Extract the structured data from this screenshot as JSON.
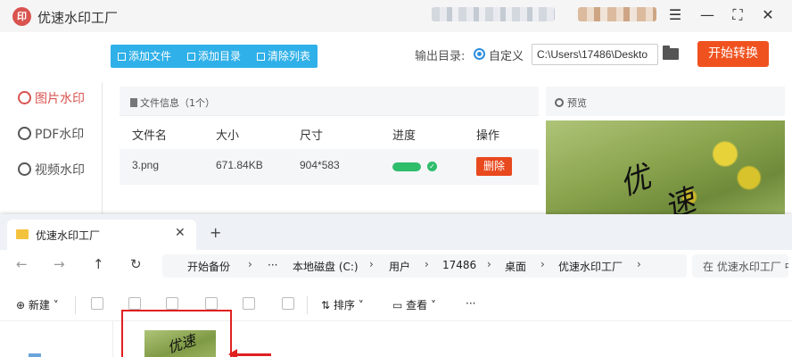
{
  "app": {
    "title": "优速水印工厂",
    "logo_text": "印",
    "window_controls": {
      "menu": "☰",
      "minimize": "—",
      "maximize": "⛶",
      "close": "✕"
    }
  },
  "sidebar": {
    "items": [
      {
        "label": "图片水印",
        "active": true
      },
      {
        "label": "PDF水印",
        "active": false
      },
      {
        "label": "视频水印",
        "active": false
      }
    ]
  },
  "toolbar": {
    "add_file": "添加文件",
    "add_dir": "添加目录",
    "clear_list": "清除列表"
  },
  "output": {
    "label": "输出目录:",
    "option": "自定义",
    "path": "C:\\Users\\17486\\Deskto",
    "start_button": "开始转换"
  },
  "file_panel": {
    "title": "文件信息（1个）",
    "columns": [
      "文件名",
      "大小",
      "尺寸",
      "进度",
      "操作"
    ],
    "rows": [
      {
        "name": "3.png",
        "size": "671.84KB",
        "dimensions": "904*583",
        "progress": 1.0,
        "action": "删除"
      }
    ]
  },
  "preview": {
    "title": "预览",
    "watermark_chars": [
      "优",
      "速"
    ]
  },
  "explorer": {
    "tab_title": "优速水印工厂",
    "tab_close": "✕",
    "new_tab": "+",
    "nav": {
      "back": "←",
      "forward": "→",
      "up": "↑",
      "refresh": "↻"
    },
    "breadcrumbs": {
      "home": "开始备份",
      "more": "···",
      "items": [
        "本地磁盘 (C:)",
        "用户",
        "17486",
        "桌面",
        "优速水印工厂"
      ]
    },
    "search_placeholder": "在 优速水印工厂 中",
    "commands": {
      "new": "新建",
      "sort": "排序",
      "view": "查看",
      "more": "···"
    },
    "thumb_watermark": "优速"
  },
  "colors": {
    "accent_red": "#f0521f",
    "delete_red": "#e8491e",
    "toolbar_blue": "#2fb0e8",
    "progress_green": "#2ebd6b",
    "highlight_red": "#e02020"
  }
}
